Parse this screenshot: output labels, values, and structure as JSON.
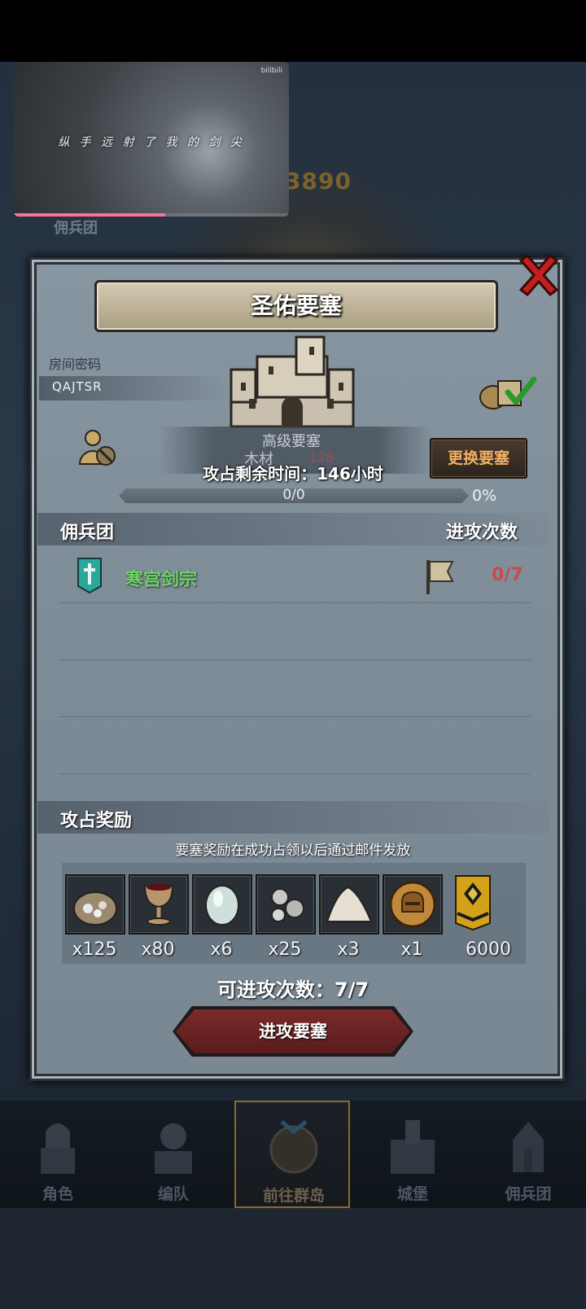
{
  "video": {
    "caption": "纵 手 远 射 了 我 的 剑 尖",
    "watermark": "bilibili",
    "progress": 0.55
  },
  "background": {
    "score": "3890",
    "merc_tab": "佣兵团"
  },
  "dialog": {
    "title": "圣佑要塞",
    "room_label": "房间密码",
    "room_code": "QAJTSR",
    "fort_level": "高级要塞",
    "wood_label": "木材",
    "wood_cost": "-128",
    "change_button": "更换要塞",
    "remaining_time": "攻占剩余时间：146小时",
    "progress_text": "0/0",
    "progress_pct": "0%",
    "mercenary_header": "佣兵团",
    "attack_count_header": "进攻次数",
    "guilds": [
      {
        "name": "寒宫剑宗",
        "count": "0/7"
      }
    ],
    "reward_header": "攻占奖励",
    "reward_note": "要塞奖励在成功占领以后通过邮件发放",
    "rewards": [
      {
        "icon": "ore-sack-icon",
        "qty": "x125"
      },
      {
        "icon": "goblet-icon",
        "qty": "x80"
      },
      {
        "icon": "gemstone-icon",
        "qty": "x6"
      },
      {
        "icon": "silver-nuggets-icon",
        "qty": "x25"
      },
      {
        "icon": "salt-pile-icon",
        "qty": "x3"
      },
      {
        "icon": "helmet-medal-icon",
        "qty": "x1"
      },
      {
        "icon": "rank-badge-icon",
        "qty": "6000"
      }
    ],
    "available_attacks": "可进攻次数：7/7",
    "attack_button": "进攻要塞"
  },
  "nav": {
    "items": [
      {
        "label": "角色",
        "icon": "knight-icon"
      },
      {
        "label": "编队",
        "icon": "squad-icon"
      },
      {
        "label": "前往群岛",
        "icon": "compass-icon"
      },
      {
        "label": "城堡",
        "icon": "castle-icon"
      },
      {
        "label": "佣兵团",
        "icon": "mercenary-icon"
      }
    ]
  },
  "colors": {
    "guild_green": "#6fd16c",
    "count_red": "#c44c4c",
    "change_button_text": "#f0b064"
  }
}
